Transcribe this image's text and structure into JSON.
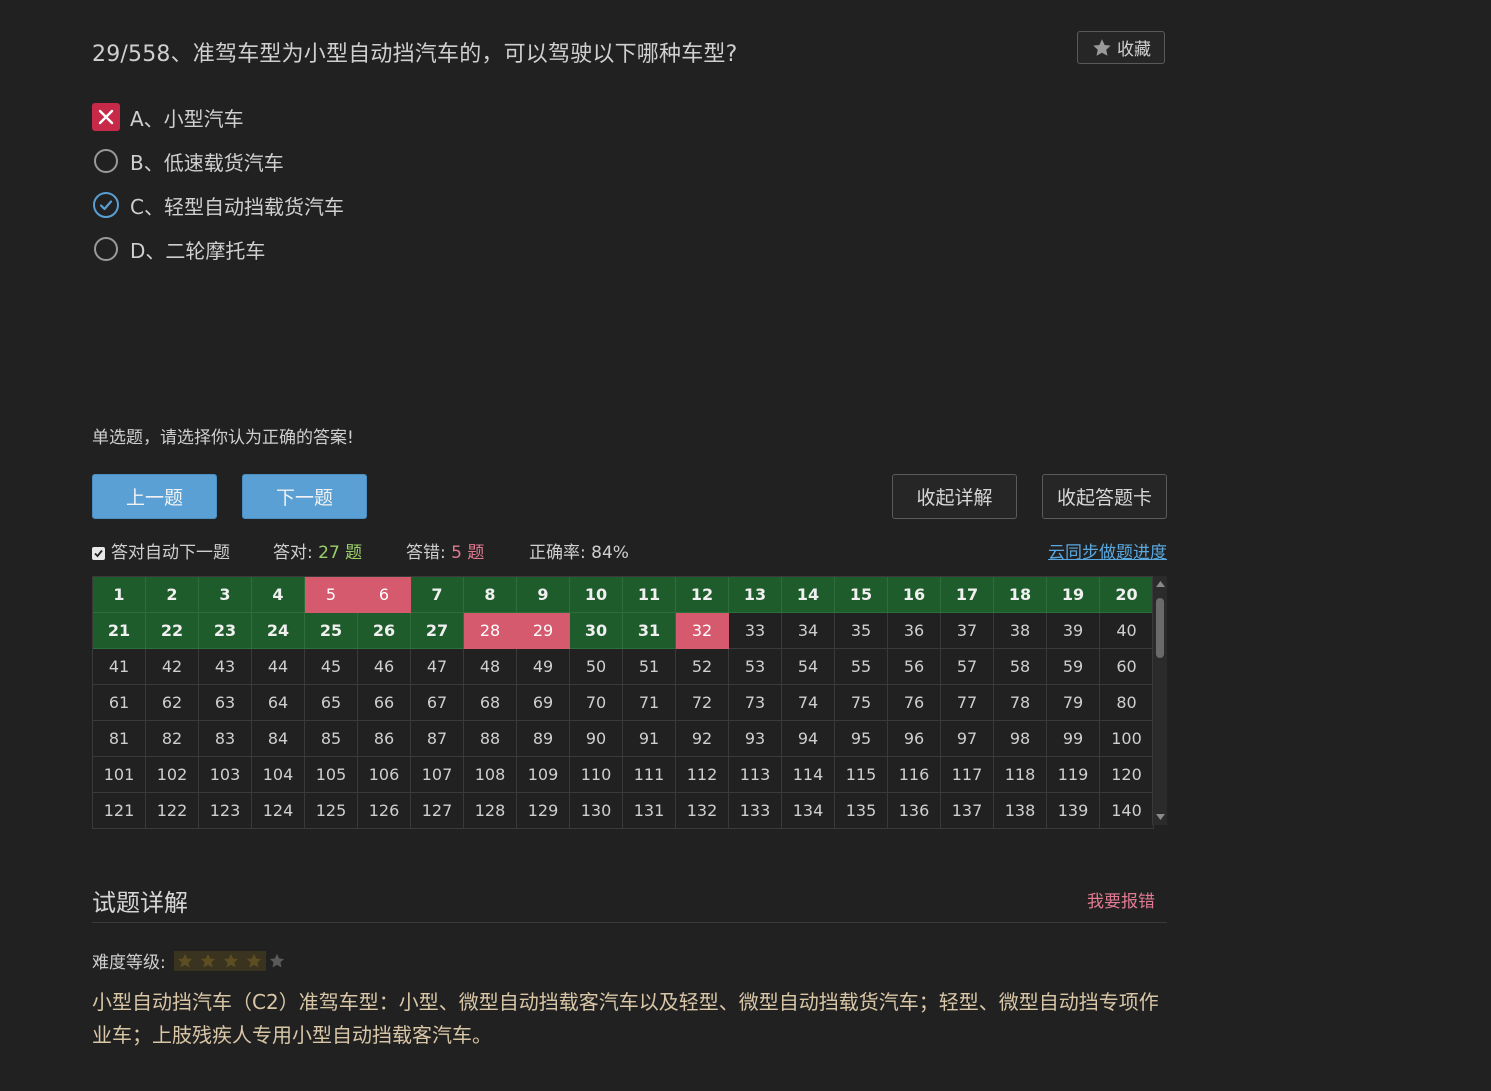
{
  "question": {
    "title": "29/558、准驾车型为小型自动挡汽车的，可以驾驶以下哪种车型?",
    "favorite_label": "收藏",
    "options": [
      {
        "label": "A、小型汽车",
        "state": "wrong"
      },
      {
        "label": "B、低速载货汽车",
        "state": "none"
      },
      {
        "label": "C、轻型自动挡载货汽车",
        "state": "correct"
      },
      {
        "label": "D、二轮摩托车",
        "state": "none"
      }
    ],
    "hint": "单选题，请选择你认为正确的答案!"
  },
  "controls": {
    "prev_label": "上一题",
    "next_label": "下一题",
    "collapse_detail_label": "收起详解",
    "collapse_card_label": "收起答题卡"
  },
  "stats": {
    "auto_next_label": "答对自动下一题",
    "auto_next_checked": true,
    "correct_prefix": "答对:",
    "correct_value": "27 题",
    "wrong_prefix": "答错:",
    "wrong_value": "5 题",
    "accuracy_label": "正确率:",
    "accuracy_value": "84%",
    "sync_label": "云同步做题进度"
  },
  "answer_card": {
    "rows": [
      [
        1,
        2,
        3,
        4,
        5,
        6,
        7,
        8,
        9,
        10,
        11,
        12,
        13,
        14,
        15,
        16,
        17,
        18,
        19,
        20
      ],
      [
        21,
        22,
        23,
        24,
        25,
        26,
        27,
        28,
        29,
        30,
        31,
        32,
        33,
        34,
        35,
        36,
        37,
        38,
        39,
        40
      ],
      [
        41,
        42,
        43,
        44,
        45,
        46,
        47,
        48,
        49,
        50,
        51,
        52,
        53,
        54,
        55,
        56,
        57,
        58,
        59,
        60
      ],
      [
        61,
        62,
        63,
        64,
        65,
        66,
        67,
        68,
        69,
        70,
        71,
        72,
        73,
        74,
        75,
        76,
        77,
        78,
        79,
        80
      ],
      [
        81,
        82,
        83,
        84,
        85,
        86,
        87,
        88,
        89,
        90,
        91,
        92,
        93,
        94,
        95,
        96,
        97,
        98,
        99,
        100
      ],
      [
        101,
        102,
        103,
        104,
        105,
        106,
        107,
        108,
        109,
        110,
        111,
        112,
        113,
        114,
        115,
        116,
        117,
        118,
        119,
        120
      ],
      [
        121,
        122,
        123,
        124,
        125,
        126,
        127,
        128,
        129,
        130,
        131,
        132,
        133,
        134,
        135,
        136,
        137,
        138,
        139,
        140
      ]
    ],
    "correct": [
      1,
      2,
      3,
      4,
      7,
      8,
      9,
      10,
      11,
      12,
      13,
      14,
      15,
      16,
      17,
      18,
      19,
      20,
      21,
      22,
      23,
      24,
      25,
      26,
      27,
      30,
      31
    ],
    "wrong": [
      5,
      6,
      28,
      29,
      32
    ],
    "colors": {
      "correct": "#1f5c2c",
      "wrong": "#d65a6e"
    }
  },
  "detail": {
    "title": "试题详解",
    "report_label": "我要报错",
    "difficulty_label": "难度等级:",
    "difficulty_stars": 4,
    "difficulty_max": 5,
    "explanation": "小型自动挡汽车（C2）准驾车型：小型、微型自动挡载客汽车以及轻型、微型自动挡载货汽车；轻型、微型自动挡专项作业车；上肢残疾人专用小型自动挡载客汽车。"
  }
}
